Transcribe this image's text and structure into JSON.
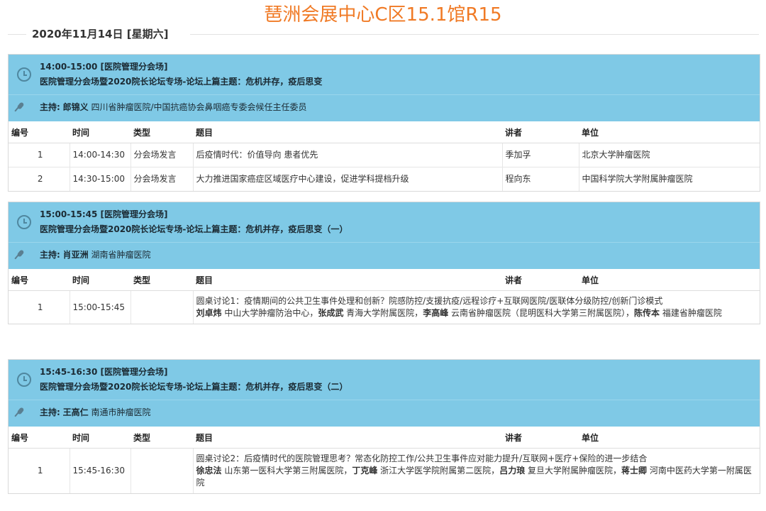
{
  "header": {
    "venue": "琶洲会展中心C区15.1馆R15",
    "date": "2020年11月14日 [星期六]"
  },
  "columns": [
    "编号",
    "时间",
    "类型",
    "题目",
    "讲者",
    "单位"
  ],
  "sessions": [
    {
      "time_line": "14:00-15:00  [医院管理分会场]",
      "title": "医院管理分会场暨2020院长论坛专场-论坛上篇主题：危机并存，疫后思变",
      "host_label": "主持:",
      "host_name": "郎锦义",
      "host_org": "四川省肿瘤医院/中国抗癌协会鼻咽癌专委会候任主任委员",
      "rows": [
        {
          "no": "1",
          "time": "14:00-14:30",
          "type": "分会场发言",
          "topic": "后疫情时代：价值导向 患者优先",
          "speaker": "季加孚",
          "unit": "北京大学肿瘤医院"
        },
        {
          "no": "2",
          "time": "14:30-15:00",
          "type": "分会场发言",
          "topic": "大力推进国家癌症区域医疗中心建设，促进学科提档升级",
          "speaker": "程向东",
          "unit": "中国科学院大学附属肿瘤医院"
        }
      ]
    },
    {
      "time_line": "15:00-15:45  [医院管理分会场]",
      "title": "医院管理分会场暨2020院长论坛专场-论坛上篇主题：危机并存，疫后思变（一）",
      "host_label": "主持:",
      "host_name": "肖亚洲",
      "host_org": "湖南省肿瘤医院",
      "row": {
        "no": "1",
        "time": "15:00-15:45",
        "type": "",
        "topic": "圆桌讨论1：疫情期间的公共卫生事件处理和创新？院感防控/支援抗疫/远程诊疗+互联网医院/医联体分级防控/创新门诊模式",
        "panel": [
          {
            "name": "刘卓炜",
            "org": " 中山大学肿瘤防治中心，"
          },
          {
            "name": "张成武",
            "org": " 青海大学附属医院，"
          },
          {
            "name": "李高峰",
            "org": " 云南省肿瘤医院（昆明医科大学第三附属医院），"
          },
          {
            "name": "陈传本",
            "org": " 福建省肿瘤医院"
          }
        ],
        "speaker": "",
        "unit": ""
      }
    },
    {
      "time_line": "15:45-16:30  [医院管理分会场]",
      "title": "医院管理分会场暨2020院长论坛专场-论坛上篇主题：危机并存，疫后思变（二）",
      "host_label": "主持:",
      "host_name": "王高仁",
      "host_org": "南通市肿瘤医院",
      "row": {
        "no": "1",
        "time": "15:45-16:30",
        "type": "",
        "topic": "圆桌讨论2：后疫情时代的医院管理思考？常态化防控工作/公共卫生事件应对能力提升/互联网+医疗+保险的进一步结合",
        "panel": [
          {
            "name": "徐忠法",
            "org": " 山东第一医科大学第三附属医院，"
          },
          {
            "name": "丁克峰",
            "org": " 浙江大学医学院附属第二医院，"
          },
          {
            "name": "吕力琅",
            "org": " 复旦大学附属肿瘤医院，"
          },
          {
            "name": "蒋士卿",
            "org": " 河南中医药大学第一附属医院"
          }
        ],
        "speaker": "",
        "unit": ""
      }
    }
  ]
}
